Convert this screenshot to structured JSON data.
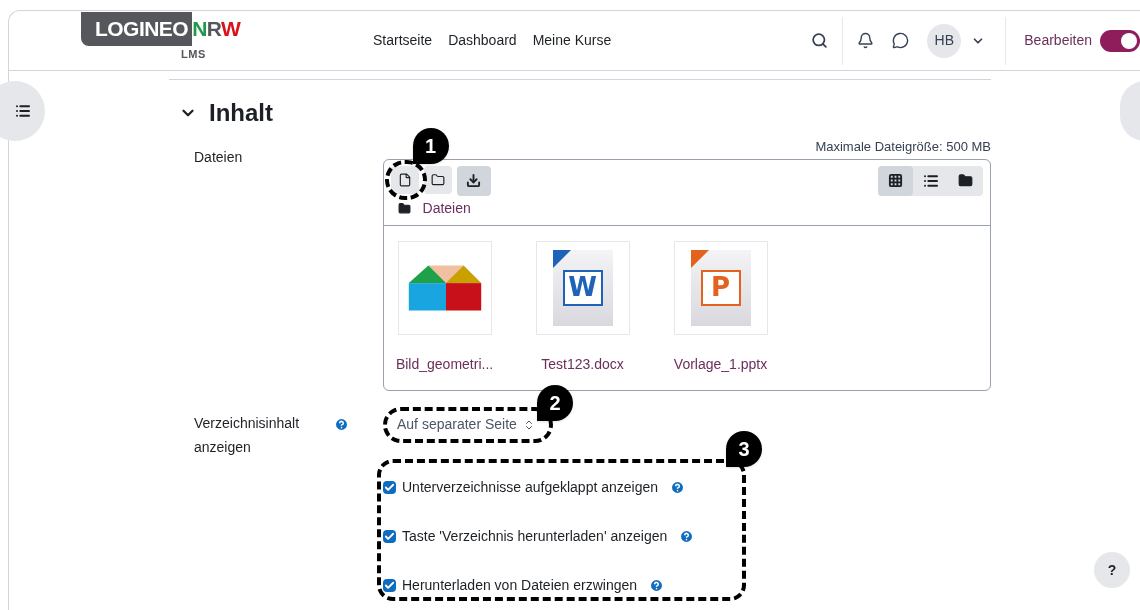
{
  "header": {
    "logo": {
      "main": "LOGINEO",
      "accent": [
        {
          "text": "N",
          "color": "#1f9a4c"
        },
        {
          "text": "R",
          "color": "#55575c"
        },
        {
          "text": "W",
          "color": "#d7141e"
        }
      ],
      "sub": "LMS"
    },
    "nav": [
      "Startseite",
      "Dashboard",
      "Meine Kurse"
    ],
    "avatar": "HB",
    "edit_mode": {
      "label": "Bearbeiten",
      "on": true
    }
  },
  "section": {
    "title": "Inhalt",
    "expanded": true
  },
  "files_field": {
    "label": "Dateien",
    "max_size": "Maximale Dateigröße: 500 MB",
    "views": [
      {
        "kind": "grid",
        "selected": true
      },
      {
        "kind": "list",
        "selected": false
      },
      {
        "kind": "tree",
        "selected": false
      }
    ],
    "path": "Dateien",
    "files": [
      {
        "name": "Bild_geometri..."
      },
      {
        "kind": "word",
        "name": "Test123.docx",
        "icon_letter": "W"
      },
      {
        "kind": "powerpoint",
        "name": "Vorlage_1.pptx",
        "icon_letter": "P"
      }
    ]
  },
  "display_field": {
    "label": "Verzeichnisinhalt anzeigen",
    "value": "Auf separater Seite"
  },
  "options": [
    {
      "label": "Unterverzeichnisse aufgeklappt anzeigen",
      "checked": true
    },
    {
      "label": "Taste 'Verzeichnis herunterladen' anzeigen",
      "checked": true
    },
    {
      "label": "Herunterladen von Dateien erzwingen",
      "checked": true
    }
  ],
  "annotations": [
    "1",
    "2",
    "3"
  ],
  "help_button": "?"
}
